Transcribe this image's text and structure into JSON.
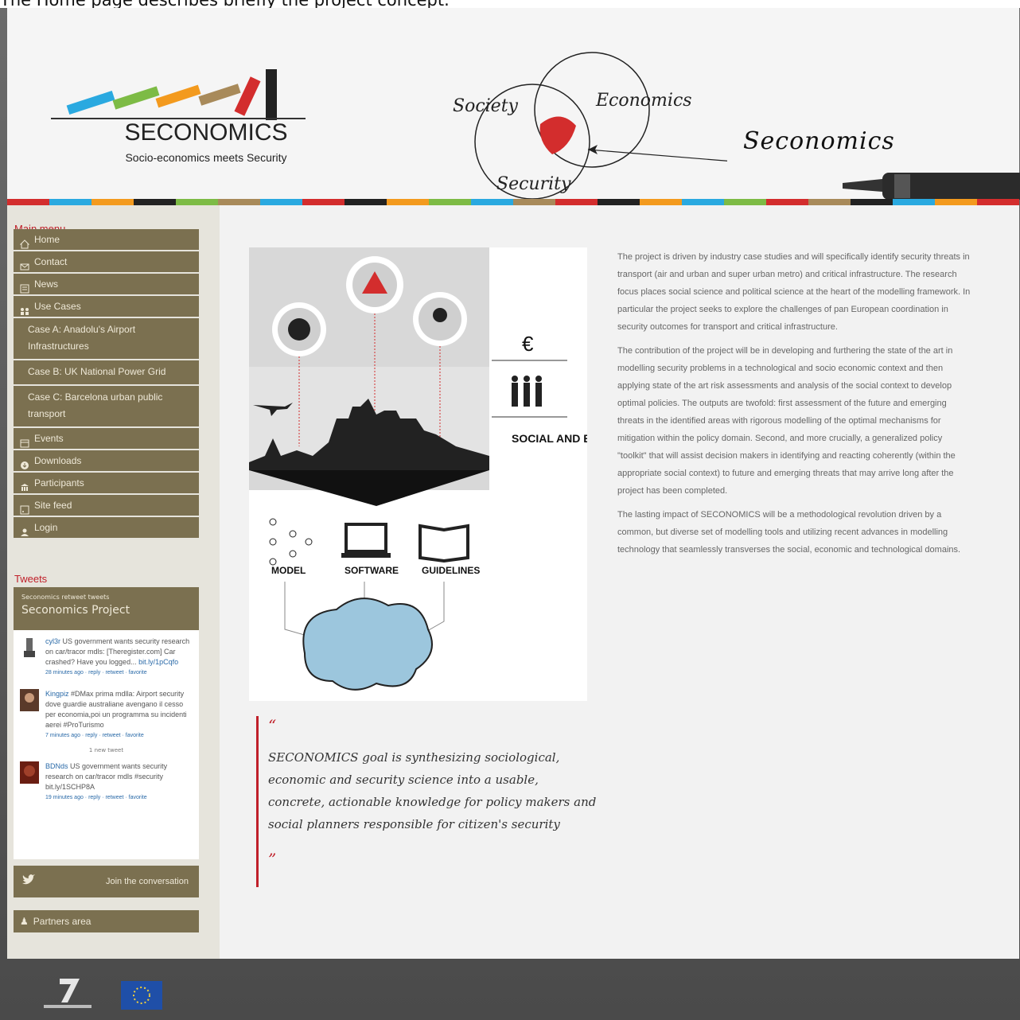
{
  "caption": "The Home page describes briefly the project concept.",
  "header": {
    "logo_title": "SECONOMICS",
    "logo_subtitle": "Socio-economics meets Security",
    "venn": {
      "society": "Society",
      "economics": "Economics",
      "security": "Security"
    },
    "script_title": "Seconomics",
    "stripe_colors": [
      "#2aa9e0",
      "#7dbb45",
      "#f39a1e",
      "#a88a5a",
      "#d32d2d",
      "#222222"
    ]
  },
  "sidebar": {
    "main_menu_label": "Main menu",
    "menu": [
      {
        "label": "Home",
        "icon": "home-icon"
      },
      {
        "label": "Contact",
        "icon": "mail-icon"
      },
      {
        "label": "News",
        "icon": "news-icon"
      },
      {
        "label": "Use Cases",
        "icon": "people-icon"
      },
      {
        "label": "Case A: Anadolu's Airport Infrastructures",
        "icon": ""
      },
      {
        "label": "Case B: UK National Power Grid",
        "icon": ""
      },
      {
        "label": "Case C: Barcelona urban public transport",
        "icon": ""
      },
      {
        "label": "Events",
        "icon": "calendar-icon"
      },
      {
        "label": "Downloads",
        "icon": "download-icon"
      },
      {
        "label": "Participants",
        "icon": "building-icon"
      },
      {
        "label": "Site feed",
        "icon": "feed-icon"
      },
      {
        "label": "Login",
        "icon": "user-icon"
      }
    ],
    "tweets_label": "Tweets",
    "tweets_small": "Seconomics retweet tweets",
    "tweets_title": "Seconomics Project",
    "tweets": [
      {
        "who": "cyl3r",
        "text": "US government wants security research on car/tracor mdls: [Theregister.com] Car crashed? Have you logged...",
        "link": "bit.ly/1pCqfo",
        "meta": "28 minutes ago · reply · retweet · favorite"
      },
      {
        "who": "Kingpiz",
        "text": "#DMax prima mdlla: Airport security dove guardie australiane avengano il cesso per economia,poi un programma su incidenti aerei #ProTurismo",
        "link": "",
        "meta": "7 minutes ago · reply · retweet · favorite"
      },
      {
        "who": "BDNds",
        "text": "US government wants security research on car/tracor mdls #security bit.ly/1SCHP8A",
        "link": "",
        "meta": "19 minutes ago · reply · retweet · favorite"
      }
    ],
    "tweets_more": "1 new tweet",
    "join_label": "Join the conversation",
    "partners_label": "Partners area"
  },
  "infographic": {
    "euro": "€",
    "impact_label": "SOCIAL AND ECONOMICS IMPACT",
    "model": "MODEL",
    "software": "SOFTWARE",
    "guidelines": "GUIDELINES"
  },
  "quote": {
    "open": "“",
    "close": "”",
    "text": "SECONOMICS goal is synthesizing sociological, economic and security science into a usable, concrete, actionable knowledge for policy makers and social planners responsible for citizen's security"
  },
  "body": {
    "p1": "The project is driven by industry case studies and will specifically identify security threats in transport (air and urban and super urban metro) and critical infrastructure. The research focus places social science and political science at the heart of the modelling framework. In particular the project seeks to explore the challenges of pan European coordination in security outcomes for transport and critical infrastructure.",
    "p2": "The contribution of the project will be in developing and furthering the state of the art in modelling security problems in a technological and socio economic context and then applying state of the art risk assessments and analysis of the social context to develop optimal policies. The outputs are twofold: first assessment of the future and emerging threats in the identified areas with rigorous modelling of the optimal mechanisms for mitigation within the policy domain. Second, and more crucially, a generalized policy \"toolkit\" that will assist decision makers in identifying and reacting coherently (within the appropriate social context) to future and emerging threats that may arrive long after the project has been completed.",
    "p3": "The lasting impact of SECONOMICS will be a methodological revolution driven by a common, but diverse set of modelling tools and utilizing recent advances in modelling technology that seamlessly transverses the social, economic and technological domains."
  },
  "colors": {
    "accent": "#c0202a",
    "menu_bg": "#7b7050",
    "menu_text": "#efe9d8"
  }
}
